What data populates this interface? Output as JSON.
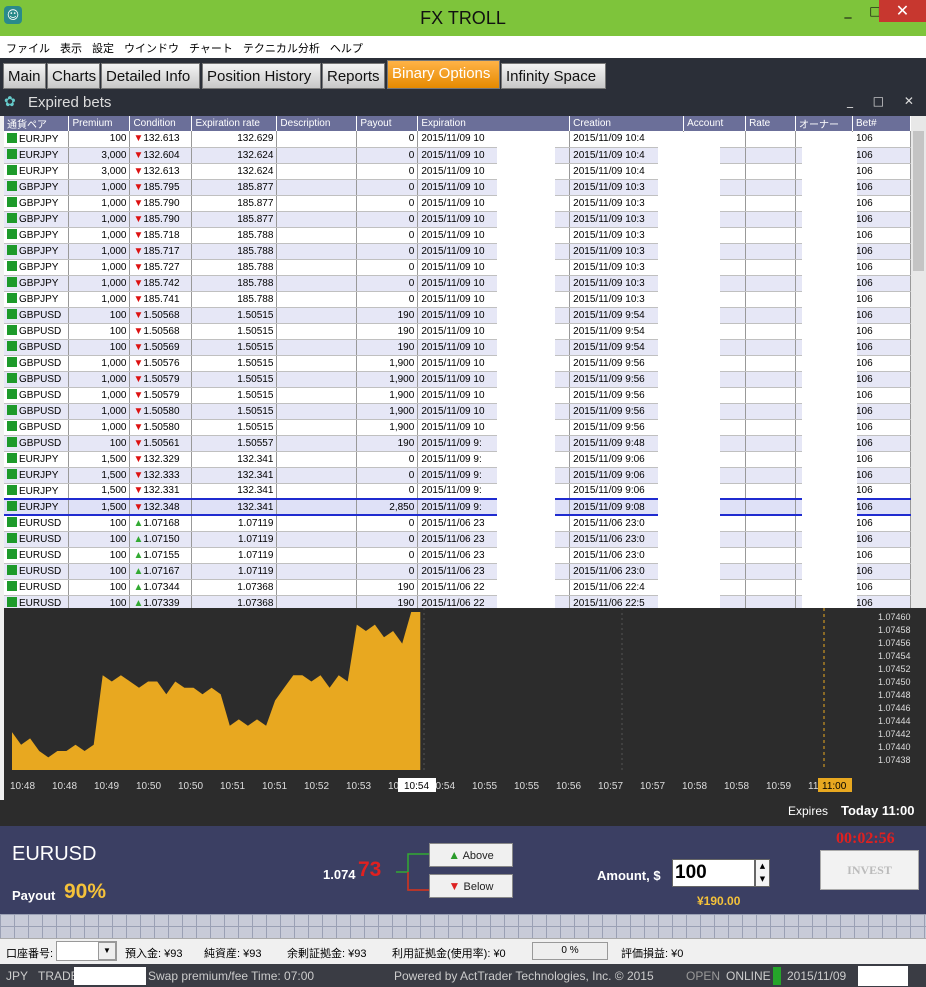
{
  "window": {
    "title": "FX TROLL",
    "minimize": "_",
    "maximize": "□",
    "close": "✕",
    "icon": "troll-logo-icon"
  },
  "menu": [
    "ファイル",
    "表示",
    "設定",
    "ウインドウ",
    "チャート",
    "テクニカル分析",
    "ヘルプ"
  ],
  "tabs": [
    {
      "label": "Main",
      "active": false
    },
    {
      "label": "Charts",
      "active": false
    },
    {
      "label": "Detailed Info",
      "active": false
    },
    {
      "label": "Position History",
      "active": false
    },
    {
      "label": "Reports",
      "active": false
    },
    {
      "label": "Binary Options",
      "active": true
    },
    {
      "label": "Infinity Space",
      "active": false
    }
  ],
  "panel": {
    "title": "Expired bets",
    "controls": "_ □ ✕"
  },
  "table": {
    "columns": [
      "通貨ペア",
      "Premium",
      "Condition",
      "Expiration rate",
      "Description",
      "Payout",
      "Expiration",
      "Creation",
      "Account",
      "Rate",
      "オーナー",
      "Bet#"
    ],
    "rows": [
      {
        "pair": "EURJPY",
        "premium": "100",
        "dir": "down",
        "cond": "132.613",
        "exp_rate": "132.629",
        "payout": "0",
        "exp": "2015/11/09 10",
        "created": "2015/11/09 10:4",
        "bet": "106"
      },
      {
        "pair": "EURJPY",
        "premium": "3,000",
        "dir": "down",
        "cond": "132.604",
        "exp_rate": "132.624",
        "payout": "0",
        "exp": "2015/11/09 10",
        "created": "2015/11/09 10:4",
        "bet": "106"
      },
      {
        "pair": "EURJPY",
        "premium": "3,000",
        "dir": "down",
        "cond": "132.613",
        "exp_rate": "132.624",
        "payout": "0",
        "exp": "2015/11/09 10",
        "created": "2015/11/09 10:4",
        "bet": "106"
      },
      {
        "pair": "GBPJPY",
        "premium": "1,000",
        "dir": "down",
        "cond": "185.795",
        "exp_rate": "185.877",
        "payout": "0",
        "exp": "2015/11/09 10",
        "created": "2015/11/09 10:3",
        "bet": "106"
      },
      {
        "pair": "GBPJPY",
        "premium": "1,000",
        "dir": "down",
        "cond": "185.790",
        "exp_rate": "185.877",
        "payout": "0",
        "exp": "2015/11/09 10",
        "created": "2015/11/09 10:3",
        "bet": "106"
      },
      {
        "pair": "GBPJPY",
        "premium": "1,000",
        "dir": "down",
        "cond": "185.790",
        "exp_rate": "185.877",
        "payout": "0",
        "exp": "2015/11/09 10",
        "created": "2015/11/09 10:3",
        "bet": "106"
      },
      {
        "pair": "GBPJPY",
        "premium": "1,000",
        "dir": "down",
        "cond": "185.718",
        "exp_rate": "185.788",
        "payout": "0",
        "exp": "2015/11/09 10",
        "created": "2015/11/09 10:3",
        "bet": "106"
      },
      {
        "pair": "GBPJPY",
        "premium": "1,000",
        "dir": "down",
        "cond": "185.717",
        "exp_rate": "185.788",
        "payout": "0",
        "exp": "2015/11/09 10",
        "created": "2015/11/09 10:3",
        "bet": "106"
      },
      {
        "pair": "GBPJPY",
        "premium": "1,000",
        "dir": "down",
        "cond": "185.727",
        "exp_rate": "185.788",
        "payout": "0",
        "exp": "2015/11/09 10",
        "created": "2015/11/09 10:3",
        "bet": "106"
      },
      {
        "pair": "GBPJPY",
        "premium": "1,000",
        "dir": "down",
        "cond": "185.742",
        "exp_rate": "185.788",
        "payout": "0",
        "exp": "2015/11/09 10",
        "created": "2015/11/09 10:3",
        "bet": "106"
      },
      {
        "pair": "GBPJPY",
        "premium": "1,000",
        "dir": "down",
        "cond": "185.741",
        "exp_rate": "185.788",
        "payout": "0",
        "exp": "2015/11/09 10",
        "created": "2015/11/09 10:3",
        "bet": "106"
      },
      {
        "pair": "GBPUSD",
        "premium": "100",
        "dir": "down",
        "cond": "1.50568",
        "exp_rate": "1.50515",
        "payout": "190",
        "exp": "2015/11/09 10",
        "created": "2015/11/09 9:54",
        "bet": "106"
      },
      {
        "pair": "GBPUSD",
        "premium": "100",
        "dir": "down",
        "cond": "1.50568",
        "exp_rate": "1.50515",
        "payout": "190",
        "exp": "2015/11/09 10",
        "created": "2015/11/09 9:54",
        "bet": "106"
      },
      {
        "pair": "GBPUSD",
        "premium": "100",
        "dir": "down",
        "cond": "1.50569",
        "exp_rate": "1.50515",
        "payout": "190",
        "exp": "2015/11/09 10",
        "created": "2015/11/09 9:54",
        "bet": "106"
      },
      {
        "pair": "GBPUSD",
        "premium": "1,000",
        "dir": "down",
        "cond": "1.50576",
        "exp_rate": "1.50515",
        "payout": "1,900",
        "exp": "2015/11/09 10",
        "created": "2015/11/09 9:56",
        "bet": "106"
      },
      {
        "pair": "GBPUSD",
        "premium": "1,000",
        "dir": "down",
        "cond": "1.50579",
        "exp_rate": "1.50515",
        "payout": "1,900",
        "exp": "2015/11/09 10",
        "created": "2015/11/09 9:56",
        "bet": "106"
      },
      {
        "pair": "GBPUSD",
        "premium": "1,000",
        "dir": "down",
        "cond": "1.50579",
        "exp_rate": "1.50515",
        "payout": "1,900",
        "exp": "2015/11/09 10",
        "created": "2015/11/09 9:56",
        "bet": "106"
      },
      {
        "pair": "GBPUSD",
        "premium": "1,000",
        "dir": "down",
        "cond": "1.50580",
        "exp_rate": "1.50515",
        "payout": "1,900",
        "exp": "2015/11/09 10",
        "created": "2015/11/09 9:56",
        "bet": "106"
      },
      {
        "pair": "GBPUSD",
        "premium": "1,000",
        "dir": "down",
        "cond": "1.50580",
        "exp_rate": "1.50515",
        "payout": "1,900",
        "exp": "2015/11/09 10",
        "created": "2015/11/09 9:56",
        "bet": "106"
      },
      {
        "pair": "GBPUSD",
        "premium": "100",
        "dir": "down",
        "cond": "1.50561",
        "exp_rate": "1.50557",
        "payout": "190",
        "exp": "2015/11/09 9:",
        "created": "2015/11/09 9:48",
        "bet": "106"
      },
      {
        "pair": "EURJPY",
        "premium": "1,500",
        "dir": "down",
        "cond": "132.329",
        "exp_rate": "132.341",
        "payout": "0",
        "exp": "2015/11/09 9:",
        "created": "2015/11/09 9:06",
        "bet": "106"
      },
      {
        "pair": "EURJPY",
        "premium": "1,500",
        "dir": "down",
        "cond": "132.333",
        "exp_rate": "132.341",
        "payout": "0",
        "exp": "2015/11/09 9:",
        "created": "2015/11/09 9:06",
        "bet": "106"
      },
      {
        "pair": "EURJPY",
        "premium": "1,500",
        "dir": "down",
        "cond": "132.331",
        "exp_rate": "132.341",
        "payout": "0",
        "exp": "2015/11/09 9:",
        "created": "2015/11/09 9:06",
        "bet": "106"
      },
      {
        "pair": "EURJPY",
        "premium": "1,500",
        "dir": "down",
        "cond": "132.348",
        "exp_rate": "132.341",
        "payout": "2,850",
        "exp": "2015/11/09 9:",
        "created": "2015/11/09 9:08",
        "bet": "106",
        "selected": true
      },
      {
        "pair": "EURUSD",
        "premium": "100",
        "dir": "up",
        "cond": "1.07168",
        "exp_rate": "1.07119",
        "payout": "0",
        "exp": "2015/11/06 23",
        "created": "2015/11/06 23:0",
        "bet": "106"
      },
      {
        "pair": "EURUSD",
        "premium": "100",
        "dir": "up",
        "cond": "1.07150",
        "exp_rate": "1.07119",
        "payout": "0",
        "exp": "2015/11/06 23",
        "created": "2015/11/06 23:0",
        "bet": "106"
      },
      {
        "pair": "EURUSD",
        "premium": "100",
        "dir": "up",
        "cond": "1.07155",
        "exp_rate": "1.07119",
        "payout": "0",
        "exp": "2015/11/06 23",
        "created": "2015/11/06 23:0",
        "bet": "106"
      },
      {
        "pair": "EURUSD",
        "premium": "100",
        "dir": "up",
        "cond": "1.07167",
        "exp_rate": "1.07119",
        "payout": "0",
        "exp": "2015/11/06 23",
        "created": "2015/11/06 23:0",
        "bet": "106"
      },
      {
        "pair": "EURUSD",
        "premium": "100",
        "dir": "up",
        "cond": "1.07344",
        "exp_rate": "1.07368",
        "payout": "190",
        "exp": "2015/11/06 22",
        "created": "2015/11/06 22:4",
        "bet": "106"
      },
      {
        "pair": "EURUSD",
        "premium": "100",
        "dir": "up",
        "cond": "1.07339",
        "exp_rate": "1.07368",
        "payout": "190",
        "exp": "2015/11/06 22",
        "created": "2015/11/06 22:5",
        "bet": "106"
      }
    ]
  },
  "chart_data": {
    "type": "area",
    "series_color": "#e8a820",
    "ylim": [
      1.07436,
      1.07461
    ],
    "y_ticks": [
      "1.07460",
      "1.07458",
      "1.07456",
      "1.07454",
      "1.07452",
      "1.07450",
      "1.07448",
      "1.07446",
      "1.07444",
      "1.07442",
      "1.07440",
      "1.07438"
    ],
    "x_ticks": [
      "10:48",
      "10:48",
      "10:49",
      "10:50",
      "10:50",
      "10:51",
      "10:51",
      "10:52",
      "10:53",
      "10:54",
      "10:54",
      "10:55",
      "10:55",
      "10:56",
      "10:57",
      "10:57",
      "10:58",
      "10:58",
      "10:59",
      "11:00"
    ],
    "current_time_label": "10:54",
    "expiry_marker_label": "11:00",
    "x_range": [
      0,
      19
    ],
    "x": [
      0,
      0.2,
      0.4,
      0.6,
      0.8,
      1,
      1.2,
      1.4,
      1.6,
      1.8,
      2,
      2.2,
      2.4,
      2.6,
      2.8,
      3,
      3.2,
      3.4,
      3.6,
      3.8,
      4,
      4.2,
      4.4,
      4.6,
      4.8,
      5,
      5.2,
      5.4,
      5.6,
      5.8,
      6,
      6.2,
      6.4,
      6.6,
      6.8,
      7,
      7.2,
      7.4,
      7.6,
      7.8,
      8,
      8.2,
      8.4,
      8.6,
      8.8,
      9
    ],
    "values": [
      1.07442,
      1.0744,
      1.07441,
      1.07439,
      1.07438,
      1.07439,
      1.07439,
      1.0744,
      1.07439,
      1.0744,
      1.07451,
      1.0745,
      1.07451,
      1.0745,
      1.07449,
      1.0745,
      1.0745,
      1.07448,
      1.0745,
      1.07449,
      1.07449,
      1.07448,
      1.07449,
      1.07448,
      1.07443,
      1.07444,
      1.07443,
      1.07444,
      1.07443,
      1.07447,
      1.07449,
      1.07451,
      1.07451,
      1.0745,
      1.07451,
      1.07449,
      1.07451,
      1.0745,
      1.07459,
      1.07458,
      1.07459,
      1.07457,
      1.07458,
      1.07456,
      1.07461,
      1.07461
    ]
  },
  "expires": {
    "label": "Expires",
    "value": "Today 11:00"
  },
  "trade": {
    "symbol": "EURUSD",
    "payout_label": "Payout",
    "payout_value": "90%",
    "rate_prefix": "1.074",
    "rate_suffix": "73",
    "above_label": "Above",
    "below_label": "Below",
    "amount_label": "Amount, $",
    "amount_value": "100",
    "payout_amount": "¥190.00",
    "timer": "00:02:56",
    "invest_label": "INVEST"
  },
  "account": {
    "acct_label": "口座番号:",
    "deposit": "預入金: ¥93",
    "net_assets": "純資産: ¥93",
    "margin_available": "余剰証拠金: ¥93",
    "margin_used": "利用証拠金(使用率): ¥0",
    "usage_pct": "0 %",
    "unrealized": "評価損益: ¥0"
  },
  "status": {
    "currency": "JPY",
    "trade": "TRADE",
    "swap": "Swap premium/fee   Time: 07:00",
    "powered": "Powered by ActTrader Technologies, Inc. © 2015",
    "open": "OPEN",
    "online": "ONLINE",
    "date": "2015/11/09"
  }
}
